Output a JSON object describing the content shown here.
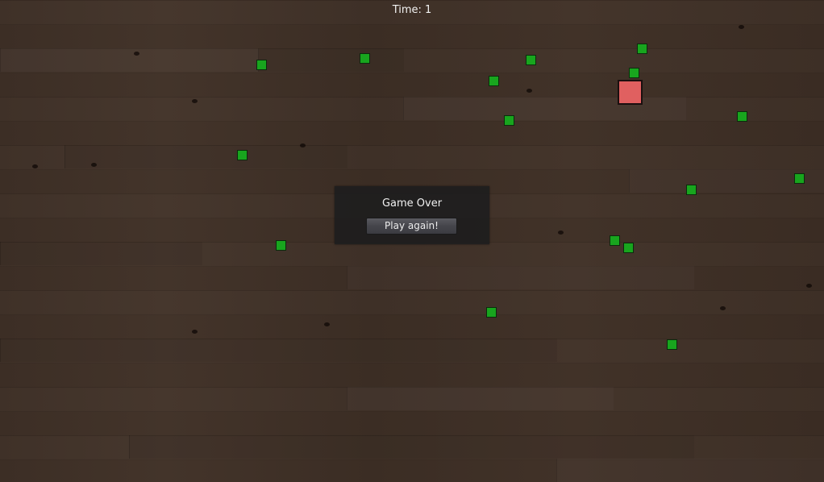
{
  "hud": {
    "time_text": "Time: 1"
  },
  "game_over": {
    "title": "Game Over",
    "button_label": "Play again!"
  },
  "colors": {
    "pellet": "#18a51e",
    "player": "#e06060",
    "panel": "#1c1c1e"
  }
}
